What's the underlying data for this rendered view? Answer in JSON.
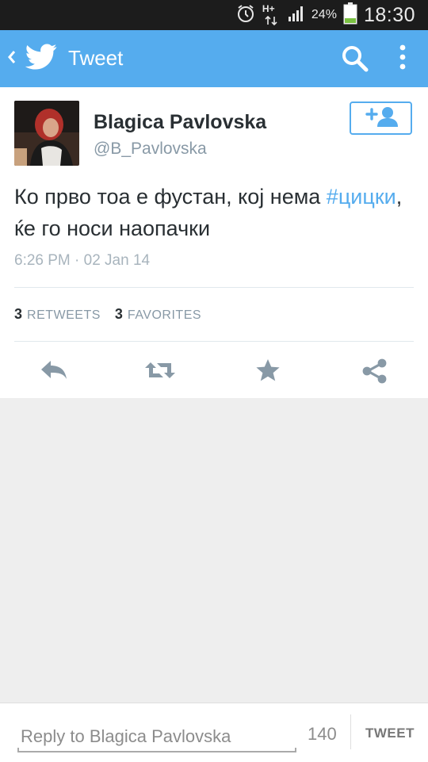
{
  "status_bar": {
    "battery_percent": "24%",
    "time": "18:30",
    "network": "H+",
    "battery_fill": 0.24,
    "icons": [
      "alarm-icon",
      "network-arrows-icon",
      "signal-icon",
      "battery-icon"
    ]
  },
  "app_bar": {
    "title": "Tweet",
    "icons": [
      "back-chevron-icon",
      "twitter-bird-icon",
      "search-icon",
      "overflow-menu-icon"
    ]
  },
  "tweet": {
    "author_name": "Blagica Pavlovska",
    "author_handle": "@B_Pavlovska",
    "text_part1": "Ко прво тоа е фустан, кој нема ",
    "hashtag": "#цицки",
    "text_part2": ", ќе го носи наопачки",
    "timestamp": "6:26 PM · 02 Jan 14",
    "retweets_count": "3",
    "retweets_label": "RETWEETS",
    "favorites_count": "3",
    "favorites_label": "FAVORITES"
  },
  "actions": [
    "reply-icon",
    "retweet-icon",
    "favorite-star-icon",
    "share-icon"
  ],
  "reply_bar": {
    "placeholder": "Reply to Blagica Pavlovska",
    "char_counter": "140",
    "tweet_button": "TWEET"
  },
  "colors": {
    "accent": "#55acee",
    "status_bar_bg": "#1c1c1c",
    "background": "#eeeeee",
    "battery_green": "#7ac142"
  }
}
